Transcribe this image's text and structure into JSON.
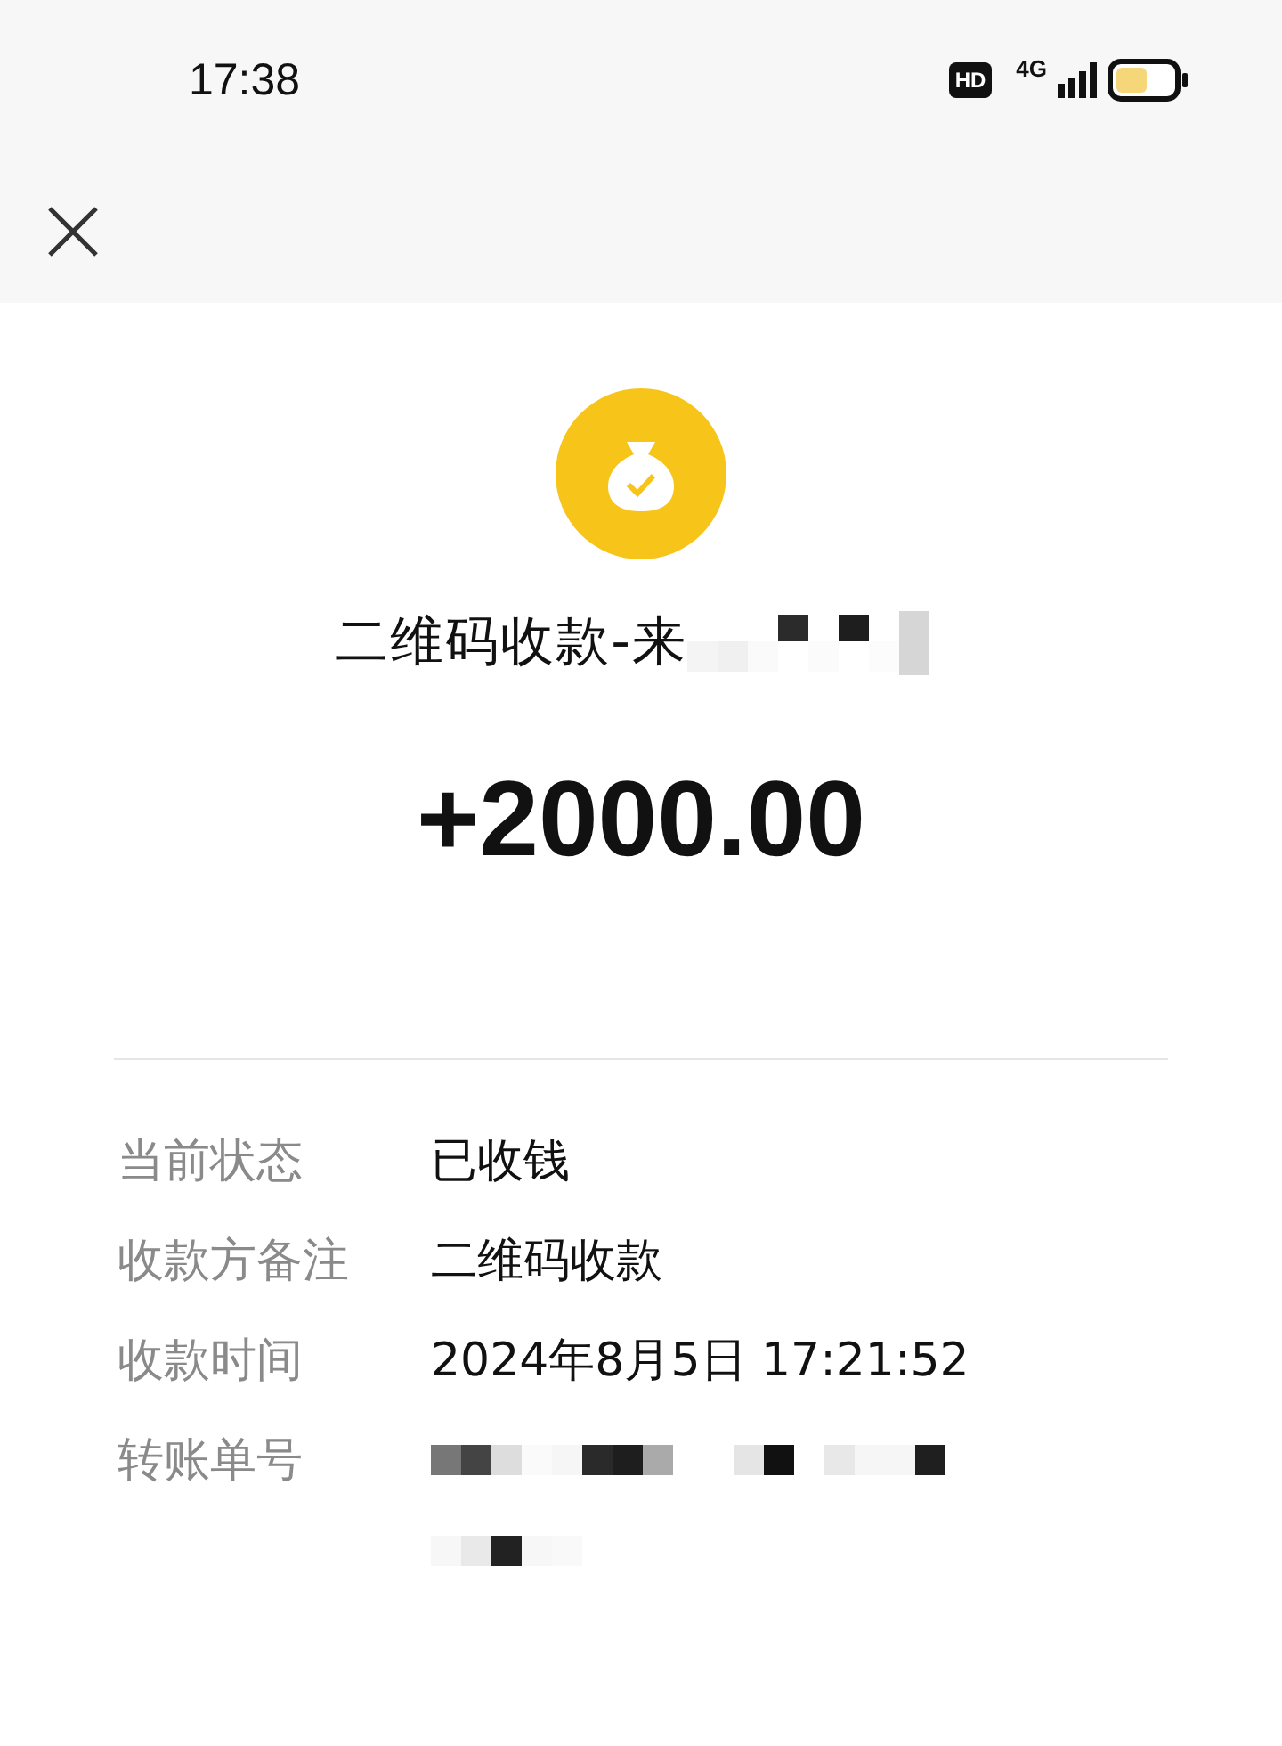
{
  "status_bar": {
    "time": "17:38",
    "hd_badge": "HD",
    "network": "4G"
  },
  "title": "二维码收款-来",
  "amount": "+2000.00",
  "details": [
    {
      "label": "当前状态",
      "value": "已收钱"
    },
    {
      "label": "收款方备注",
      "value": "二维码收款"
    },
    {
      "label": "收款时间",
      "value": "2024年8月5日 17:21:52"
    },
    {
      "label": "转账单号",
      "kind": "redacted"
    }
  ]
}
